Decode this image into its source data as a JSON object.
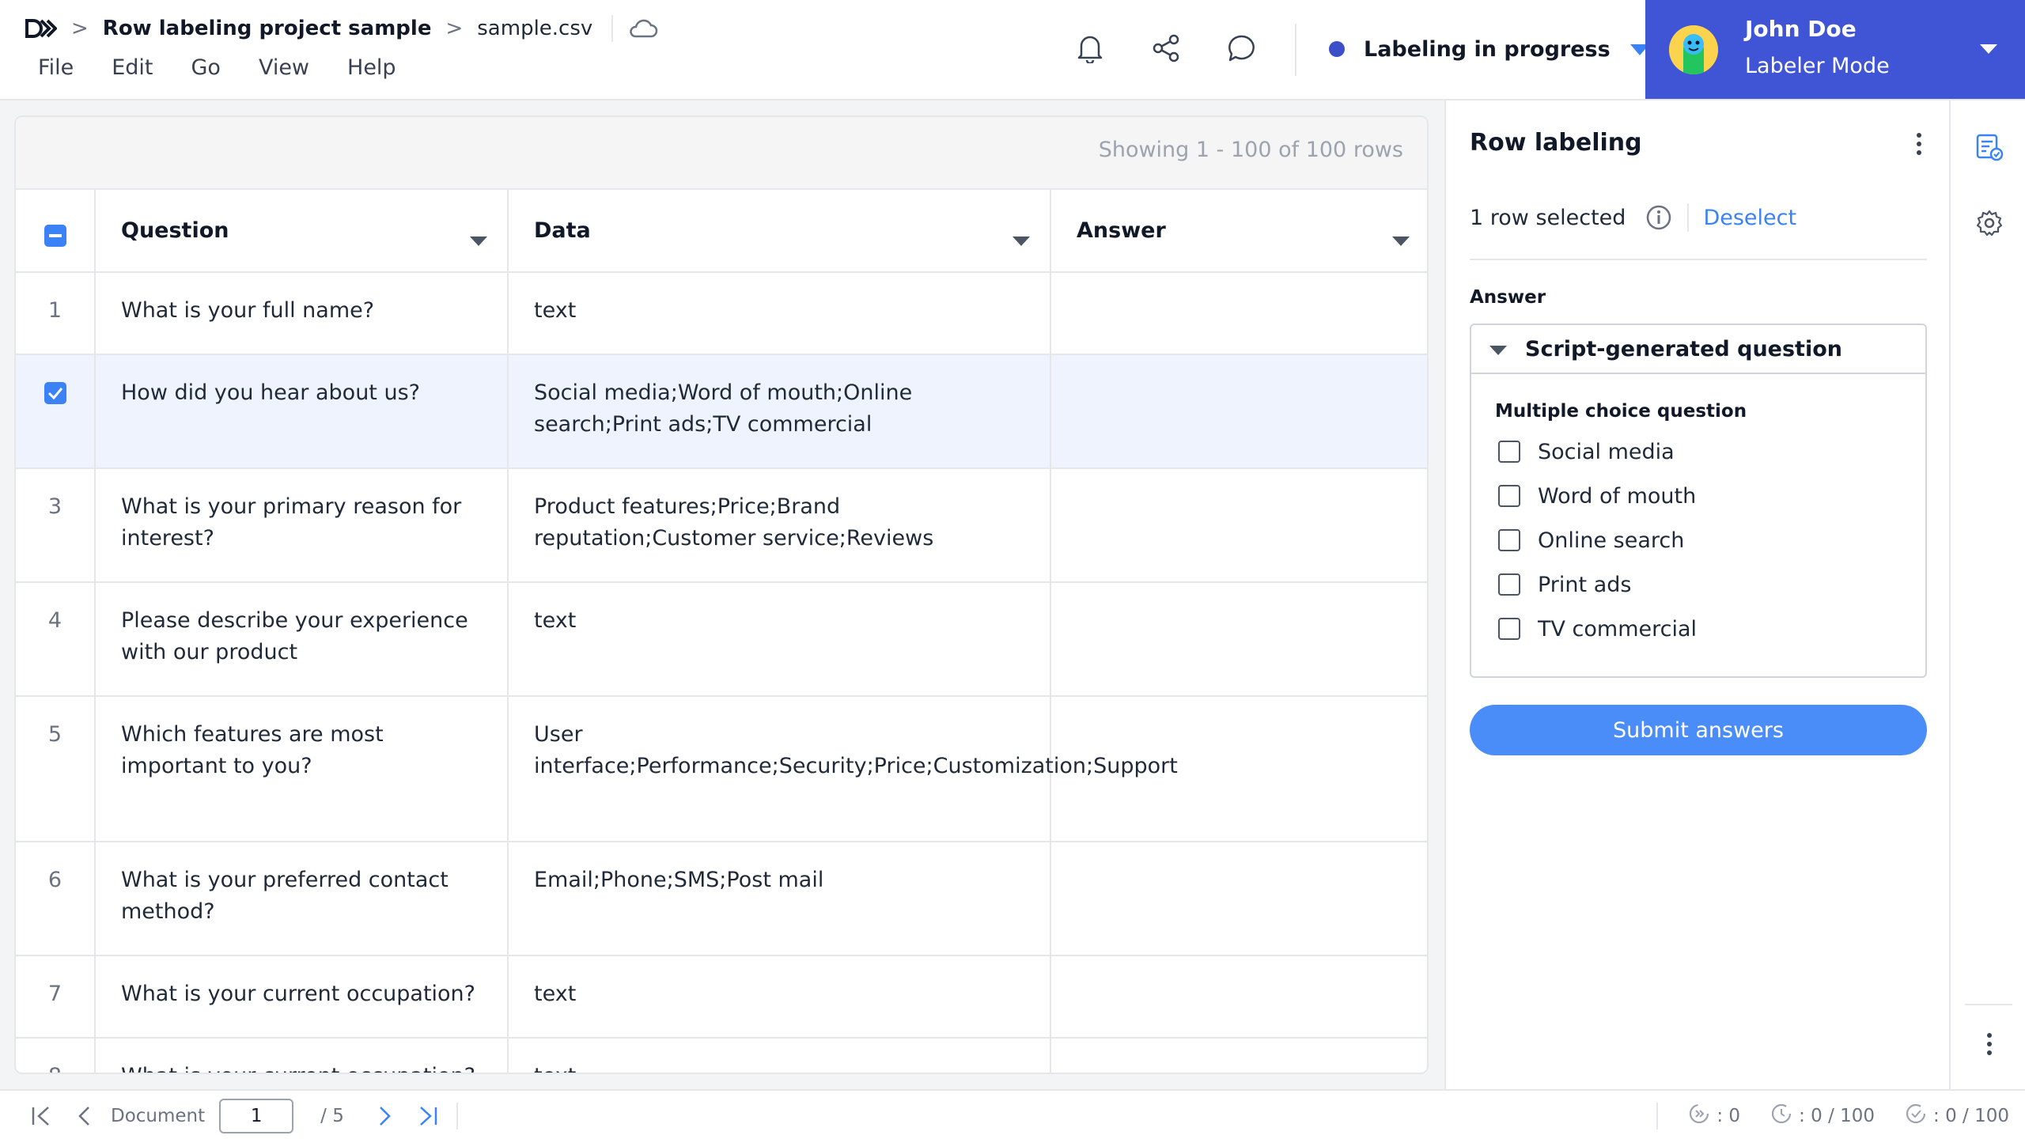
{
  "header": {
    "project": "Row labeling project sample",
    "file": "sample.csv",
    "menu": [
      "File",
      "Edit",
      "Go",
      "View",
      "Help"
    ],
    "status": "Labeling in progress",
    "status_color": "#3b4fc9"
  },
  "user": {
    "name": "John Doe",
    "mode": "Labeler Mode",
    "panel_color": "#3f55d6"
  },
  "grid": {
    "rows_info": "Showing 1 - 100 of 100 rows",
    "columns": [
      "Question",
      "Data",
      "Answer"
    ],
    "rows": [
      {
        "num": "1",
        "question": "What is your full name?",
        "data": "text",
        "answer": "",
        "selected": false
      },
      {
        "num": "",
        "question": "How did you hear about us?",
        "data": "Social media;Word of mouth;Online search;Print ads;TV commercial",
        "answer": "",
        "selected": true
      },
      {
        "num": "3",
        "question": "What is your primary reason for interest?",
        "data": "Product features;Price;Brand reputation;Customer service;Reviews",
        "answer": "",
        "selected": false
      },
      {
        "num": "4",
        "question": "Please describe your experience with our product",
        "data": "text",
        "answer": "",
        "selected": false
      },
      {
        "num": "5",
        "question": "Which features are most important to you?",
        "data": "User interface;Performance;Security;Price;Customization;Support",
        "answer": "",
        "selected": false
      },
      {
        "num": "6",
        "question": "What is your preferred contact method?",
        "data": "Email;Phone;SMS;Post mail",
        "answer": "",
        "selected": false
      },
      {
        "num": "7",
        "question": "What is your current occupation?",
        "data": "text",
        "answer": "",
        "selected": false
      },
      {
        "num": "8",
        "question": "What is your current occupation?",
        "data": "text",
        "answer": "",
        "selected": false
      }
    ]
  },
  "panel": {
    "title": "Row labeling",
    "selected_text": "1 row selected",
    "deselect": "Deselect",
    "answer_label": "Answer",
    "question_title": "Script-generated question",
    "question_type": "Multiple choice question",
    "options": [
      "Social media",
      "Word of mouth",
      "Online search",
      "Print ads",
      "TV commercial"
    ],
    "submit": "Submit answers"
  },
  "footer": {
    "doc_label": "Document",
    "page_value": "1",
    "page_total": "/ 5",
    "stat1": ": 0",
    "stat2": ": 0 / 100",
    "stat3": ": 0 / 100"
  },
  "icons": {
    "logo": "logo-icon",
    "cloud": "cloud-icon",
    "bell": "bell-icon",
    "share": "share-icon",
    "comment": "comment-icon",
    "settings": "gear-icon"
  },
  "colors": {
    "accent": "#3b82f6",
    "submit": "#4b8df8",
    "selected_row": "#eef3fd"
  }
}
